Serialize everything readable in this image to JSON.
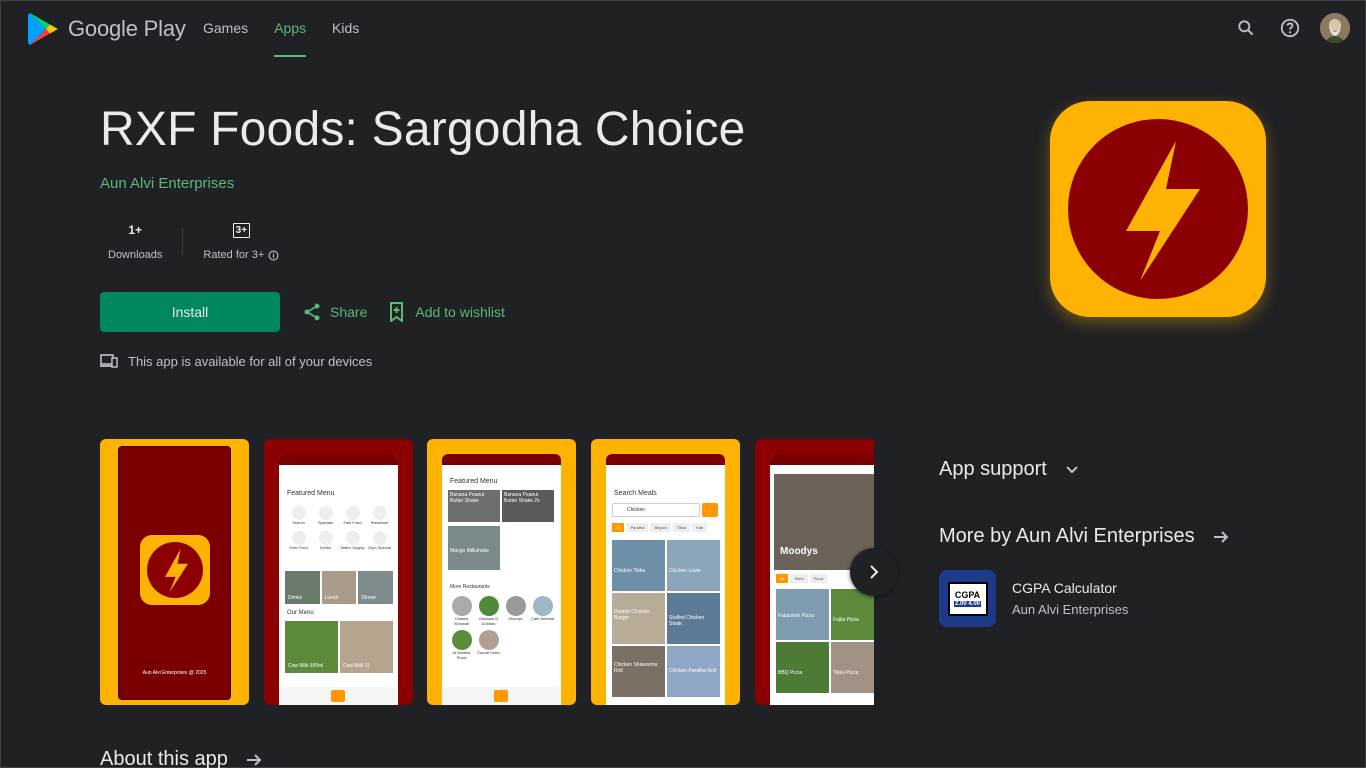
{
  "header": {
    "brand": "Google Play",
    "nav": [
      {
        "label": "Games",
        "active": false
      },
      {
        "label": "Apps",
        "active": true
      },
      {
        "label": "Kids",
        "active": false
      }
    ],
    "icons": [
      "search-icon",
      "help-icon",
      "account-avatar"
    ]
  },
  "app": {
    "title": "RXF Foods: Sargodha Choice",
    "developer": "Aun Alvi Enterprises",
    "downloads_value": "1+",
    "downloads_label": "Downloads",
    "rating_badge": "3+",
    "rating_label": "Rated for 3+",
    "install_label": "Install",
    "share_label": "Share",
    "wishlist_label": "Add to wishlist",
    "devices_text": "This app is available for all of your devices",
    "icon_colors": {
      "background": "#feb302",
      "circle": "#8b0000",
      "bolt": "#feb302"
    }
  },
  "screenshots": [
    {
      "bg": "#feb302",
      "footer": "Aun Alvi Enterprises @ 2025"
    },
    {
      "bg": "#8b0000",
      "heading": "Featured Menu",
      "items": [
        "Search",
        "Specials",
        "Fast Food",
        "Breakfast",
        "Desi Food",
        "Drinks",
        "Water Supply",
        "Gym Special"
      ],
      "tiles": [
        "Drinks",
        "Lunch",
        "Dinner"
      ],
      "subheading": "Our Menu",
      "menu": [
        "Cow Milk 500ml",
        "Cow Milk 1L"
      ]
    },
    {
      "bg": "#feb302",
      "heading": "Featured Menu",
      "tiles": [
        "Banana Peanut Butter Shake",
        "Banana Peanut Butter Shake 2x",
        "Mango Milkshake"
      ],
      "subheading": "More Restaurants",
      "restaurants": [
        "Chaska Shinwari",
        "Ghuaam N Dubban",
        "Moodys",
        "Cafe Ambala",
        "Al Madina Pizza",
        "Zardar Hotel"
      ]
    },
    {
      "bg": "#feb302",
      "heading": "Search Meals",
      "query": "Chicken",
      "chips": [
        "All",
        "Paratha",
        "Biryani",
        "Tikka",
        "Kab"
      ],
      "results": [
        "Chicken Tikka",
        "Chicken Lover",
        "Double Chicken Burger",
        "Stuffed Chicken Steak",
        "Chicken Shawarma Roll",
        "Chicken Paratha Roll"
      ]
    },
    {
      "bg": "#8b0000",
      "heading": "Moodys",
      "chips": [
        "All",
        "Steel",
        "Pizza"
      ],
      "results": [
        "Fabasheh Pizza",
        "Fajita Pizza",
        "BBQ Pizza",
        "Tikka Pizza"
      ]
    }
  ],
  "side": {
    "support_label": "App support",
    "more_by_label": "More by Aun Alvi Enterprises",
    "related": {
      "name": "CGPA Calculator",
      "developer": "Aun Alvi Enterprises",
      "icon_text": "CGPA",
      "icon_sub": "2.00 4.00"
    }
  },
  "about_label": "About this app"
}
